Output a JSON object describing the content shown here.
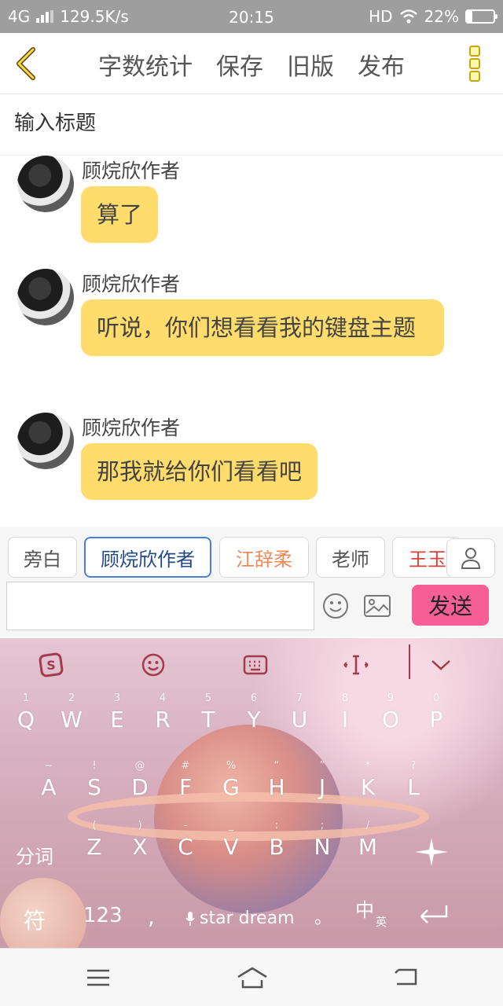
{
  "status_bar": {
    "network": "4G",
    "speed": "129.5K/s",
    "time": "20:15",
    "hd": "HD",
    "battery": "22%",
    "battery_level": 0.22
  },
  "top_bar": {
    "actions": [
      "字数统计",
      "保存",
      "旧版",
      "发布"
    ]
  },
  "title_input": {
    "placeholder": "输入标题"
  },
  "messages": [
    {
      "sender": "顾烷欣作者",
      "text": "算了"
    },
    {
      "sender": "顾烷欣作者",
      "text": "听说，你们想看看我的键盘主题"
    },
    {
      "sender": "顾烷欣作者",
      "text": "那我就给你们看看吧"
    }
  ],
  "roles": [
    {
      "label": "旁白",
      "color": "#555555"
    },
    {
      "label": "顾烷欣作者",
      "color": "#234a8a",
      "selected": true
    },
    {
      "label": "江辞柔",
      "color": "#f08a5a"
    },
    {
      "label": "老师",
      "color": "#555555"
    },
    {
      "label": "王玉",
      "color": "#d9433b"
    }
  ],
  "composer": {
    "send_label": "发送"
  },
  "keyboard": {
    "row1": [
      {
        "main": "Q",
        "sub": "1"
      },
      {
        "main": "W",
        "sub": "2"
      },
      {
        "main": "E",
        "sub": "3"
      },
      {
        "main": "R",
        "sub": "4"
      },
      {
        "main": "T",
        "sub": "5"
      },
      {
        "main": "Y",
        "sub": "6"
      },
      {
        "main": "U",
        "sub": "7"
      },
      {
        "main": "I",
        "sub": "8"
      },
      {
        "main": "O",
        "sub": "9"
      },
      {
        "main": "P",
        "sub": "0"
      }
    ],
    "row2": [
      {
        "main": "A",
        "sub": "~"
      },
      {
        "main": "S",
        "sub": "!"
      },
      {
        "main": "D",
        "sub": "@"
      },
      {
        "main": "F",
        "sub": "#"
      },
      {
        "main": "G",
        "sub": "%"
      },
      {
        "main": "H",
        "sub": "“"
      },
      {
        "main": "J",
        "sub": "”"
      },
      {
        "main": "K",
        "sub": "*"
      },
      {
        "main": "L",
        "sub": "?"
      }
    ],
    "row3": [
      {
        "main": "Z",
        "sub": "("
      },
      {
        "main": "X",
        "sub": ")"
      },
      {
        "main": "C",
        "sub": "-"
      },
      {
        "main": "V",
        "sub": "_"
      },
      {
        "main": "B",
        "sub": ":"
      },
      {
        "main": "N",
        "sub": ";"
      },
      {
        "main": "M",
        "sub": "/"
      }
    ],
    "fenci": "分词",
    "fu": "符",
    "num": "123",
    "comma": ",",
    "space_label": "star dream",
    "period": "。",
    "lang": "中",
    "lang_sub": "英"
  }
}
